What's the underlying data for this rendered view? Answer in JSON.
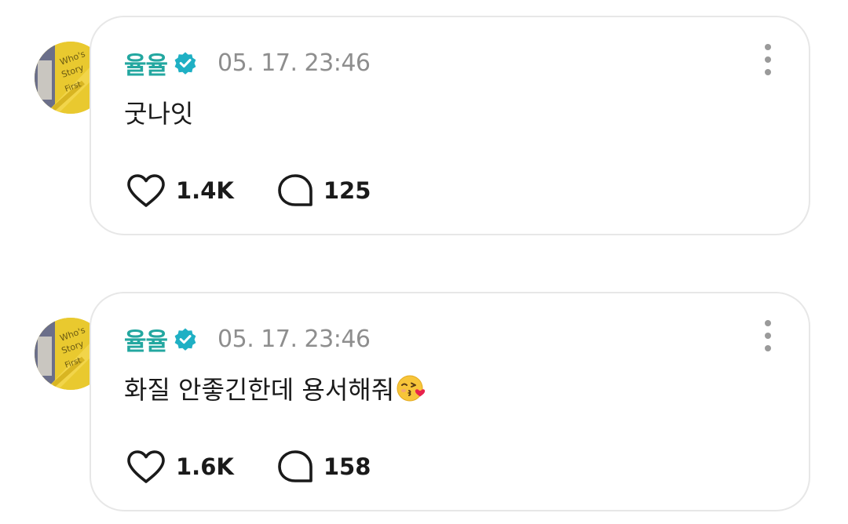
{
  "posts": [
    {
      "username": "율율",
      "timestamp": "05. 17. 23:46",
      "text": "굿나잇",
      "likes": "1.4K",
      "replies": "125",
      "emoji": ""
    },
    {
      "username": "율율",
      "timestamp": "05. 17. 23:46",
      "text": "화질 안좋긴한데 용서해줘",
      "likes": "1.6K",
      "replies": "158",
      "emoji": "kissing-face-with-heart-icon"
    }
  ],
  "colors": {
    "username": "#23a7a0",
    "verified": "#1fb0c4",
    "timestamp": "#8e8e8e",
    "card_border": "#e7e7e7",
    "avatar_bg": "#e9c92f"
  }
}
